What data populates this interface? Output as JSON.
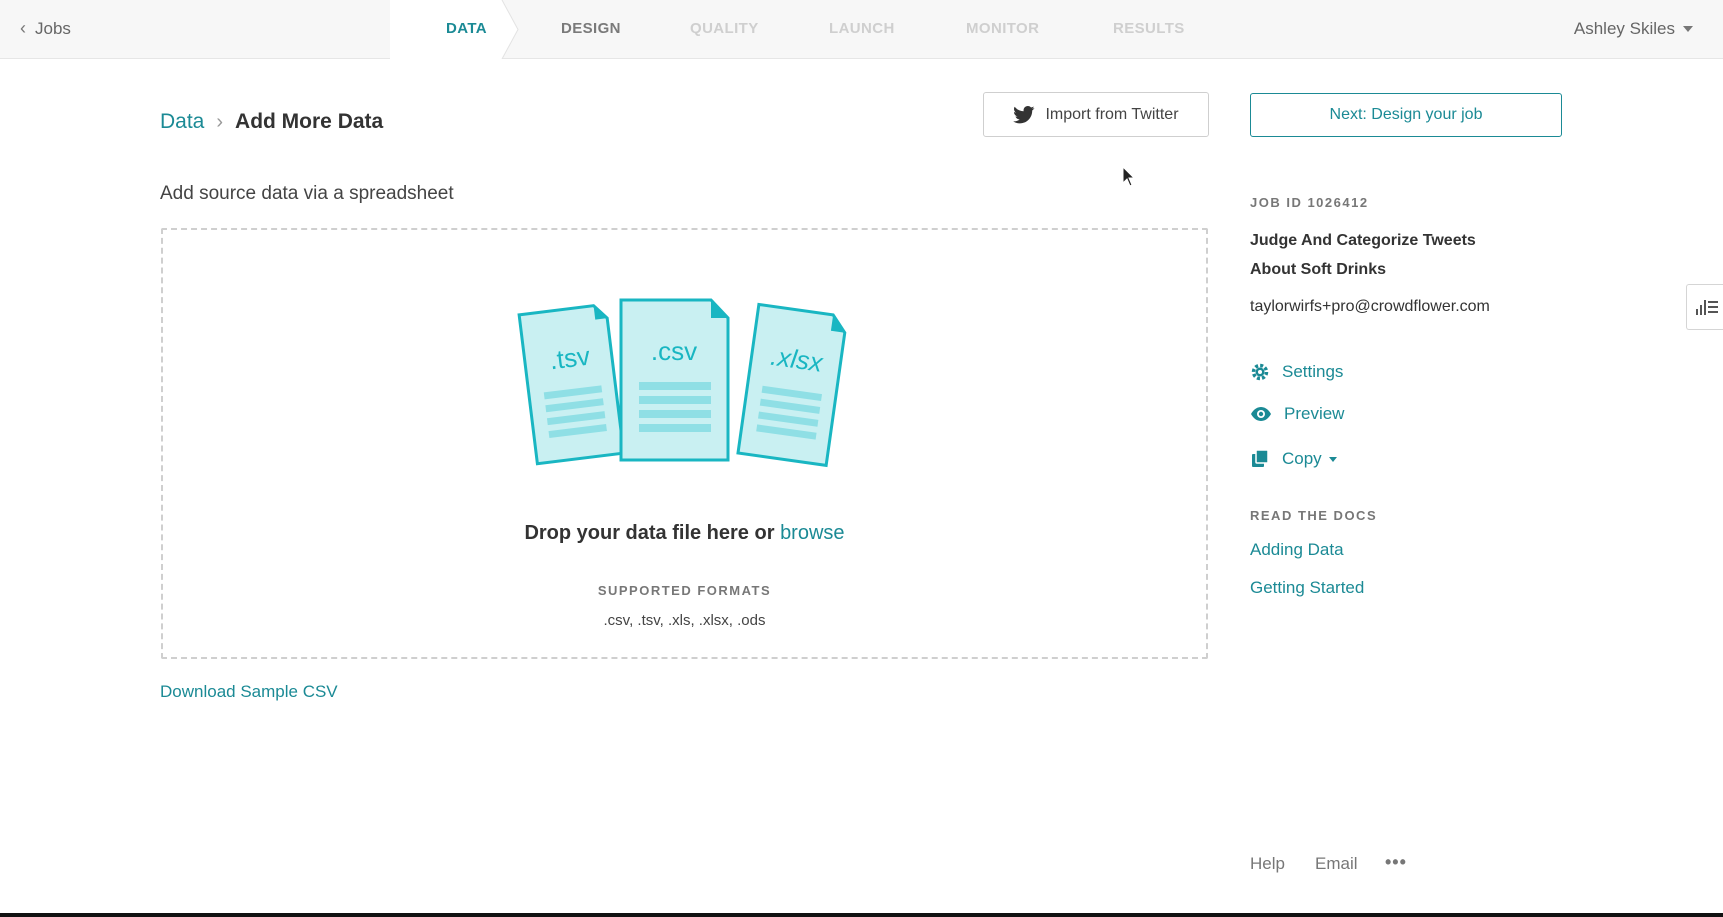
{
  "topbar": {
    "back_label": "Jobs",
    "steps": [
      {
        "label": "DATA",
        "state": "active"
      },
      {
        "label": "DESIGN",
        "state": "done"
      },
      {
        "label": "QUALITY",
        "state": "disabled"
      },
      {
        "label": "LAUNCH",
        "state": "disabled"
      },
      {
        "label": "MONITOR",
        "state": "disabled"
      },
      {
        "label": "RESULTS",
        "state": "disabled"
      }
    ],
    "user_name": "Ashley Skiles"
  },
  "breadcrumb": {
    "parent": "Data",
    "current": "Add More Data"
  },
  "actions": {
    "twitter_label": "Import from Twitter",
    "next_label": "Next: Design your job"
  },
  "upload": {
    "section_title": "Add source data via a spreadsheet",
    "file_types": [
      ".tsv",
      ".csv",
      ".xlsx"
    ],
    "drop_text": "Drop your data file here or",
    "browse_label": "browse",
    "formats_title": "SUPPORTED FORMATS",
    "formats_list": ".csv, .tsv, .xls, .xlsx, .ods",
    "download_label": "Download Sample CSV"
  },
  "job": {
    "id_label": "JOB ID 1026412",
    "title": "Judge And Categorize Tweets About Soft Drinks",
    "email": "taylorwirfs+pro@crowdflower.com",
    "settings_label": "Settings",
    "preview_label": "Preview",
    "copy_label": "Copy"
  },
  "docs": {
    "title": "READ THE DOCS",
    "links": [
      "Adding Data",
      "Getting Started"
    ]
  },
  "footer": {
    "help_label": "Help",
    "email_label": "Email",
    "more_label": "•••"
  },
  "colors": {
    "accent": "#1b8a95",
    "illustration_fill": "#c9f0f2",
    "illustration_stroke": "#19b6c2"
  }
}
